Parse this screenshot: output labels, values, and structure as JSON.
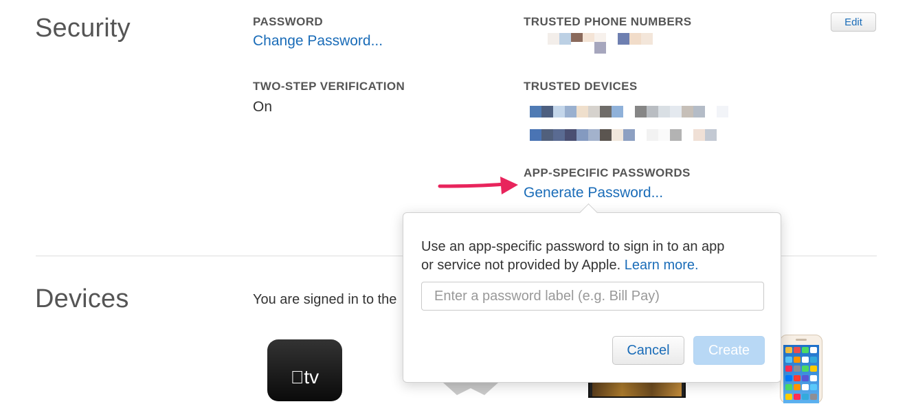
{
  "security": {
    "heading": "Security",
    "password": {
      "label": "PASSWORD",
      "link": "Change Password..."
    },
    "two_step": {
      "label": "TWO-STEP VERIFICATION",
      "value": "On"
    },
    "trusted_phones": {
      "label": "TRUSTED PHONE NUMBERS"
    },
    "trusted_devices": {
      "label": "TRUSTED DEVICES"
    },
    "app_passwords": {
      "label": "APP-SPECIFIC PASSWORDS",
      "link": "Generate Password..."
    },
    "edit_button": "Edit"
  },
  "devices": {
    "heading": "Devices",
    "intro_text": "You are signed in to the",
    "apple_tv_label": "tv"
  },
  "popover": {
    "text_line1": "Use an app-specific password to sign in to an app",
    "text_line2": "or service not provided by Apple.",
    "learn_more": "Learn more.",
    "input_placeholder": "Enter a password label (e.g. Bill Pay)",
    "input_value": "",
    "cancel": "Cancel",
    "create": "Create"
  },
  "annotation": {
    "arrow_color": "#e8245c"
  },
  "colors": {
    "link": "#1a6cb8",
    "create_disabled": "#b8d8f5"
  },
  "redacted": {
    "phone_rows": [
      [
        "#f3eeea",
        "#bcd0e4",
        "#8a6a5c",
        "#f4e4d6",
        "#f7f1ec",
        "#ffffff",
        "#6e7fb0",
        "#f1dcc9",
        "#f3e6da"
      ],
      [
        "#ffffff",
        "#ffffff",
        "#a6a6bd"
      ]
    ],
    "device_rows": [
      [
        "#4f7bb4",
        "#4d5f80",
        "#c4d6ea",
        "#9ab0cf",
        "#efdfcc",
        "#d6d2cd",
        "#6f6c69",
        "#8fb1d9",
        "#ffffff",
        "#868686",
        "#b9bdc2",
        "#d9dfe4",
        "#e4e9ef",
        "#c6bfb8",
        "#b4bcc7",
        "#ffffff",
        "#f2f4f8"
      ],
      [
        "#4a74b4",
        "#51607c",
        "#5a6b92",
        "#4a4f72",
        "#849ac0",
        "#a3b2cc",
        "#5b5550",
        "#f1e7dc",
        "#8da0c2",
        "#ffffff",
        "#f2f2f2",
        "#fafafa",
        "#b3b3b3",
        "#ffffff",
        "#f0e0d6",
        "#c3c9d3",
        "#ffffff"
      ]
    ]
  }
}
